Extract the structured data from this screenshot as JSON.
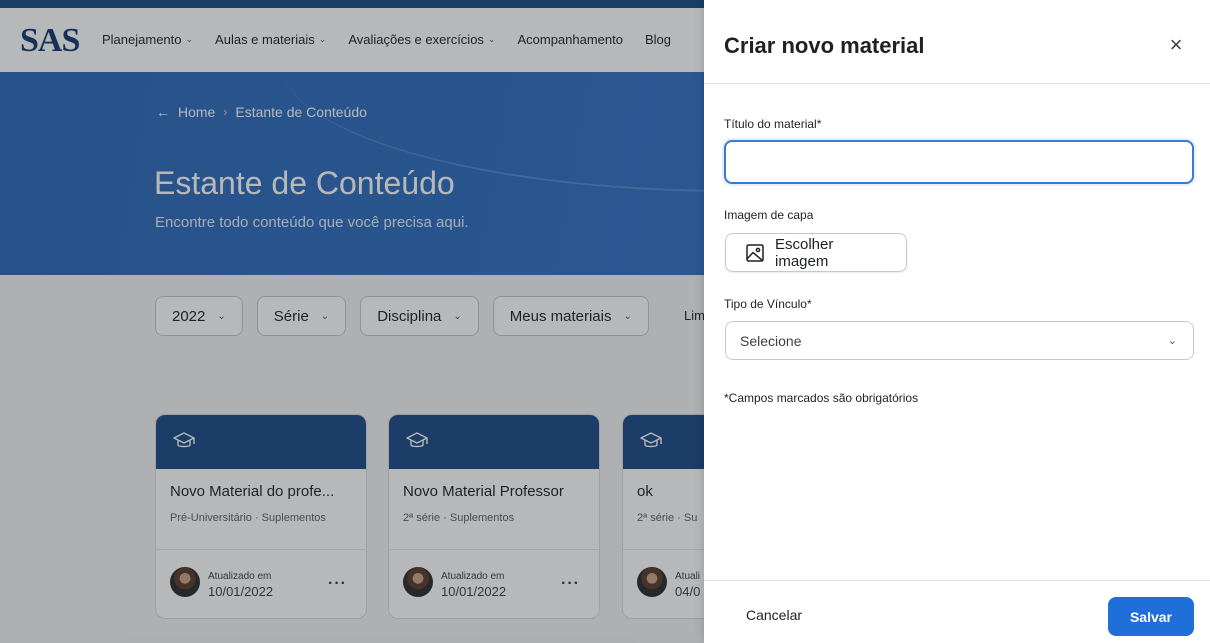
{
  "brand": {
    "logo": "SAS"
  },
  "nav": {
    "items": [
      {
        "label": "Planejamento",
        "has_dropdown": true
      },
      {
        "label": "Aulas e materiais",
        "has_dropdown": true
      },
      {
        "label": "Avaliações e exercícios",
        "has_dropdown": true
      },
      {
        "label": "Acompanhamento",
        "has_dropdown": false
      },
      {
        "label": "Blog",
        "has_dropdown": false
      }
    ]
  },
  "hero": {
    "breadcrumb": {
      "back_icon": "arrow-left-icon",
      "home": "Home",
      "current": "Estante de Conteúdo"
    },
    "title": "Estante de Conteúdo",
    "subtitle": "Encontre todo conteúdo que você precisa aqui."
  },
  "filters": {
    "items": [
      {
        "label": "2022"
      },
      {
        "label": "Série"
      },
      {
        "label": "Disciplina"
      },
      {
        "label": "Meus materiais"
      }
    ],
    "clear_label": "Lim"
  },
  "cards": [
    {
      "title": "Novo Material do profe...",
      "meta": "Pré-Universitário · Suplementos",
      "updated_label": "Atualizado em",
      "date": "10/01/2022"
    },
    {
      "title": "Novo Material Professor",
      "meta": "2ª série · Suplementos",
      "updated_label": "Atualizado em",
      "date": "10/01/2022"
    },
    {
      "title": "ok",
      "meta": "2ª série · Su",
      "updated_label": "Atuali",
      "date": "04/0"
    }
  ],
  "drawer": {
    "title": "Criar novo material",
    "close_icon": "close-icon",
    "title_field": {
      "label": "Título do material*",
      "value": "",
      "placeholder": ""
    },
    "cover": {
      "label": "Imagem de capa",
      "button_label": "Escolher imagem",
      "icon": "image-icon"
    },
    "link_type": {
      "label": "Tipo de Vínculo*",
      "selected": "Selecione"
    },
    "required_note": "*Campos marcados são obrigatórios",
    "footer": {
      "cancel_label": "Cancelar",
      "save_label": "Salvar"
    }
  },
  "colors": {
    "brand_navy": "#1b4a86",
    "hero_blue": "#2f6fc2",
    "primary_button": "#1e6fd9",
    "input_focus": "#3a7ad4"
  }
}
